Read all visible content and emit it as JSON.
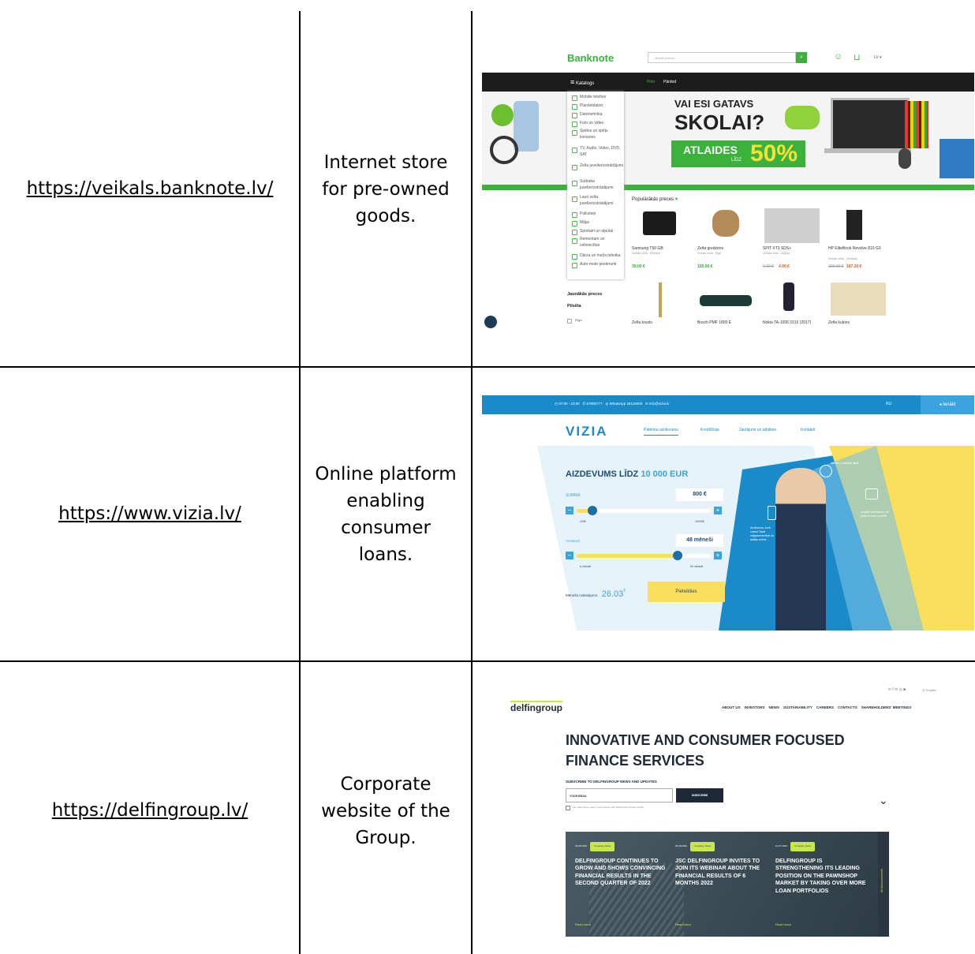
{
  "rows": [
    {
      "url": "https://veikals.banknote.lv/",
      "description_lines": [
        "Internet store",
        "for pre-owned",
        "goods."
      ],
      "screenshot": {
        "logo": "Banknote",
        "search_placeholder": "Meklēt preces",
        "lang": "LV ▾",
        "menu_label": "Katalogs",
        "nav_buy": "Pirkt",
        "nav_sell": "Pārdod",
        "categories": [
          "Mobilie telefoni",
          "Planšetdatori",
          "Datortehnika",
          "Foto un video",
          "Spēles un spēļu konsoles",
          "TV, Audio, Video, DVD, SAT",
          "Zelta juvelierizstrādājumi",
          "Sudraba juvelierizstrādājumi",
          "Lauri zelta juvelierizstrādājumi",
          "Pulksteņi",
          "Mājai",
          "Sportam un atpūtai",
          "Remontam un celtniecībai",
          "Dārza un meža tehnika",
          "Auto-moto piederumi"
        ],
        "banner_line1": "VAI ESI GATAVS",
        "banner_line2": "SKOLAI?",
        "banner_discount": "ATLAIDES",
        "banner_pct": "50%",
        "banner_lidz": "LĪDZ",
        "popular_title": "Populārākās preces",
        "newest_title": "Jaunākās preces",
        "city_title": "Pilsēta",
        "city_option": "Rīga",
        "products_row1": [
          {
            "name": "Samsung T50 GB",
            "seller": "Veikala vieta : Rēzekne",
            "price": "39.00 €",
            "old": ""
          },
          {
            "name": "Zelta gredzens",
            "seller": "Veikala vieta : Rīga",
            "price": "155.00 €",
            "old": ""
          },
          {
            "name": "SPIT XT3 SDS+",
            "seller": "Veikala vieta : Liepāja",
            "price": "4.00 €",
            "old": "6.00 €"
          },
          {
            "name": "HP EliteBook Revolve 810 G3",
            "seller": "Veikala vieta : Ventspils",
            "price": "167.20 €",
            "old": "209.00 €"
          }
        ],
        "products_row2": [
          "Zelta krusts",
          "Bosch PMF 1800 E",
          "Nokia TA-1006 3310 (2017)",
          "Zelta kulons"
        ]
      }
    },
    {
      "url": "https://www.vizia.lv/",
      "description_lines": [
        "Online platform",
        "enabling",
        "consumer",
        "loans."
      ],
      "screenshot": {
        "hours": "07:00 - 23:00",
        "phone": "67600777",
        "whatsapp": "WhatsApp 26115000",
        "email": "info@vizia.lv",
        "lang": "RU",
        "login": "Ienākt",
        "logo": "VIZIA",
        "nav": [
          "Patēriņa aizdevums",
          "Kredītlīnija",
          "Jautājumi un atbildes",
          "Kontakti"
        ],
        "heading": "AIZDEVUMS LĪDZ",
        "heading_amount": "10 000 EUR",
        "sum_label": "SUMMA",
        "sum_value": "800 €",
        "sum_min": "100€",
        "sum_max": "10000€",
        "term_label": "TERMIŅŠ",
        "term_value": "48 mēneši",
        "term_min": "6 mēneši",
        "term_max": "60 mēneši",
        "monthly_label": "Mēneša maksājums:",
        "monthly_value": "26.03",
        "monthly_unit": "€",
        "apply": "Pieteikties",
        "feature1": "Atbilde 1 minūtes laikā",
        "feature2": "Aizdevums, kurš sniedz Tavai mājsaimniecībai un labāku dzīvei",
        "feature3": "Aizpildīt pieteikumu var jebkurā laikā un vietā"
      }
    },
    {
      "url": "https://delfingroup.lv/",
      "description_lines": [
        "Corporate",
        "website of the",
        "Group."
      ],
      "screenshot": {
        "logo": "delfingroup",
        "social": "in f ✉ ◎ ▶",
        "lang": "English",
        "nav": [
          "ABOUT US",
          "INVESTORS",
          "NEWS",
          "SUSTAINABILITY",
          "CAREERS",
          "CONTACTS",
          "SHAREHOLDERS' MEETINGS"
        ],
        "headline1": "INNOVATIVE AND CONSUMER FOCUSED",
        "headline2": "FINANCE SERVICES",
        "subscribe_title": "SUBSCRIBE TO DELFINGROUP NEWS AND UPDATES",
        "email_placeholder": "YOUR EMAIL",
        "subscribe_btn": "SUBSCRIBE",
        "consent": "Your data will be used in accordance with DelfinGroup Privacy Policy",
        "news": [
          {
            "date": "30.08.2022",
            "tag": "Company News",
            "title": "DELFINGROUP CONTINUES TO GROW AND SHOWS CONVINCING FINANCIAL RESULTS IN THE SECOND QUARTER OF 2022",
            "more": "Read more"
          },
          {
            "date": "26.08.2022",
            "tag": "Company News",
            "title": "JSC DELFINGROUP INVITES TO JOIN ITS WEBINAR ABOUT THE FINANCIAL RESULTS OF 6 MONTHS 2022",
            "more": "Read more"
          },
          {
            "date": "10.07.2022",
            "tag": "Company News",
            "title": "DELFINGROUP IS STRENGTHENING ITS LEADING POSITION ON THE PAWNSHOP MARKET BY TAKING OVER MORE LOAN PORTFOLIOS",
            "more": "Read more"
          }
        ],
        "all_announcements": "All Announcements"
      }
    }
  ],
  "colors": {
    "banknote_green": "#3cb13c",
    "vizia_blue": "#1a8bc8",
    "vizia_yellow": "#f9df5b",
    "delfin_dark": "#1d2a36",
    "delfin_green": "#c8e84a"
  }
}
